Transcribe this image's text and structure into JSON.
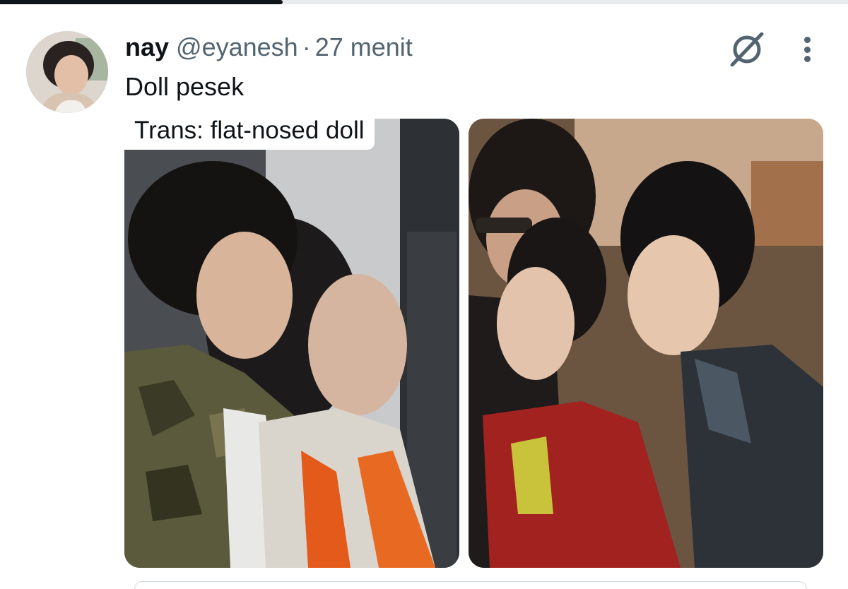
{
  "progress": {
    "fraction": 0.333
  },
  "tweet": {
    "display_name": "nay",
    "handle": "@eyanesh",
    "separator": "·",
    "time": "27 menit",
    "text": "Doll pesek",
    "media_caption": "Trans: flat-nosed doll"
  },
  "icons": {
    "grok": "grok-icon",
    "more": "more-vertical-icon"
  },
  "colors": {
    "text_primary": "#0f1419",
    "text_secondary": "#536471",
    "background": "#ffffff"
  }
}
